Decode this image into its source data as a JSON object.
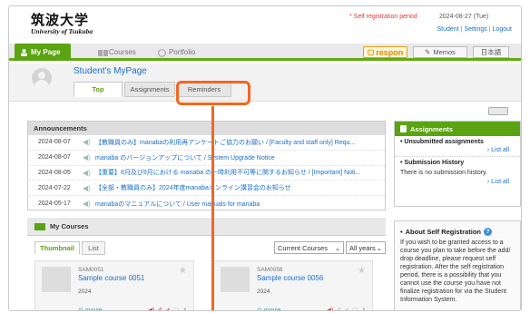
{
  "header": {
    "logo_jp": "筑波大学",
    "logo_en": "University of Tsukuba",
    "self_registration": "* Self registration period",
    "date": "2024-08-27 (Tue)",
    "links": [
      "Student",
      "Settings",
      "Logout"
    ]
  },
  "nav": {
    "tabs": [
      {
        "label": "My Page",
        "icon": "person-icon"
      },
      {
        "label": "Courses",
        "icon": "courses-icon"
      },
      {
        "label": "Portfolio",
        "icon": "portfolio-icon"
      }
    ],
    "respon": "respon",
    "memos": "Memos",
    "lang": "日本語"
  },
  "mypage": {
    "title": "Student's MyPage",
    "tabs": [
      "Top",
      "Assignments",
      "Reminders"
    ]
  },
  "announcements": {
    "title": "Announcements",
    "rows": [
      {
        "date": "2024-08-07",
        "text": "【教職員のみ】manabaの利用再アンケートご協力のお願い / [Faculty and staff only] Requ..."
      },
      {
        "date": "2024-08-07",
        "text": "manaba のバージョンアップについて / System Upgrade Notice"
      },
      {
        "date": "2024-08-05",
        "text": "【重要】8月及び9月における manaba の一時利用不可等に関するお知らせ / [Important] Noti..."
      },
      {
        "date": "2024-07-22",
        "text": "【全部・教職員のみ】2024年度manabaオンライン講習会のお知らせ"
      },
      {
        "date": "2024-05-17",
        "text": "manabaのマニュアルについて / User manuals for manaba"
      }
    ]
  },
  "assignments": {
    "title": "Assignments",
    "unsubmitted": "Unsubmitted assignments",
    "list_all_1": "List all",
    "history": "Submission History",
    "no_history": "There is no submission history.",
    "list_all_2": "List all"
  },
  "about": {
    "title": "About Self Registration",
    "text": "If you wish to be granted access to a course you plan to take before the add/ drop deadline, please request self registration. After the self registration period, there is a possibility that you cannot use the course you have not finalize registration for via the Student Information System."
  },
  "courses": {
    "title": "My Courses",
    "tabs": [
      "Thumbnail",
      "List"
    ],
    "filter": "Current Courses",
    "year": "All years",
    "cards": [
      {
        "code": "SAM0051",
        "name": "Sample course 0051",
        "year": "2024",
        "movie": "movie"
      },
      {
        "code": "SAM0056",
        "name": "Sample course 0056",
        "year": "2024",
        "movie": "movie"
      }
    ]
  },
  "colors": {
    "accent": "#5aa312",
    "link": "#1a6fc9",
    "callout": "#f26722"
  }
}
